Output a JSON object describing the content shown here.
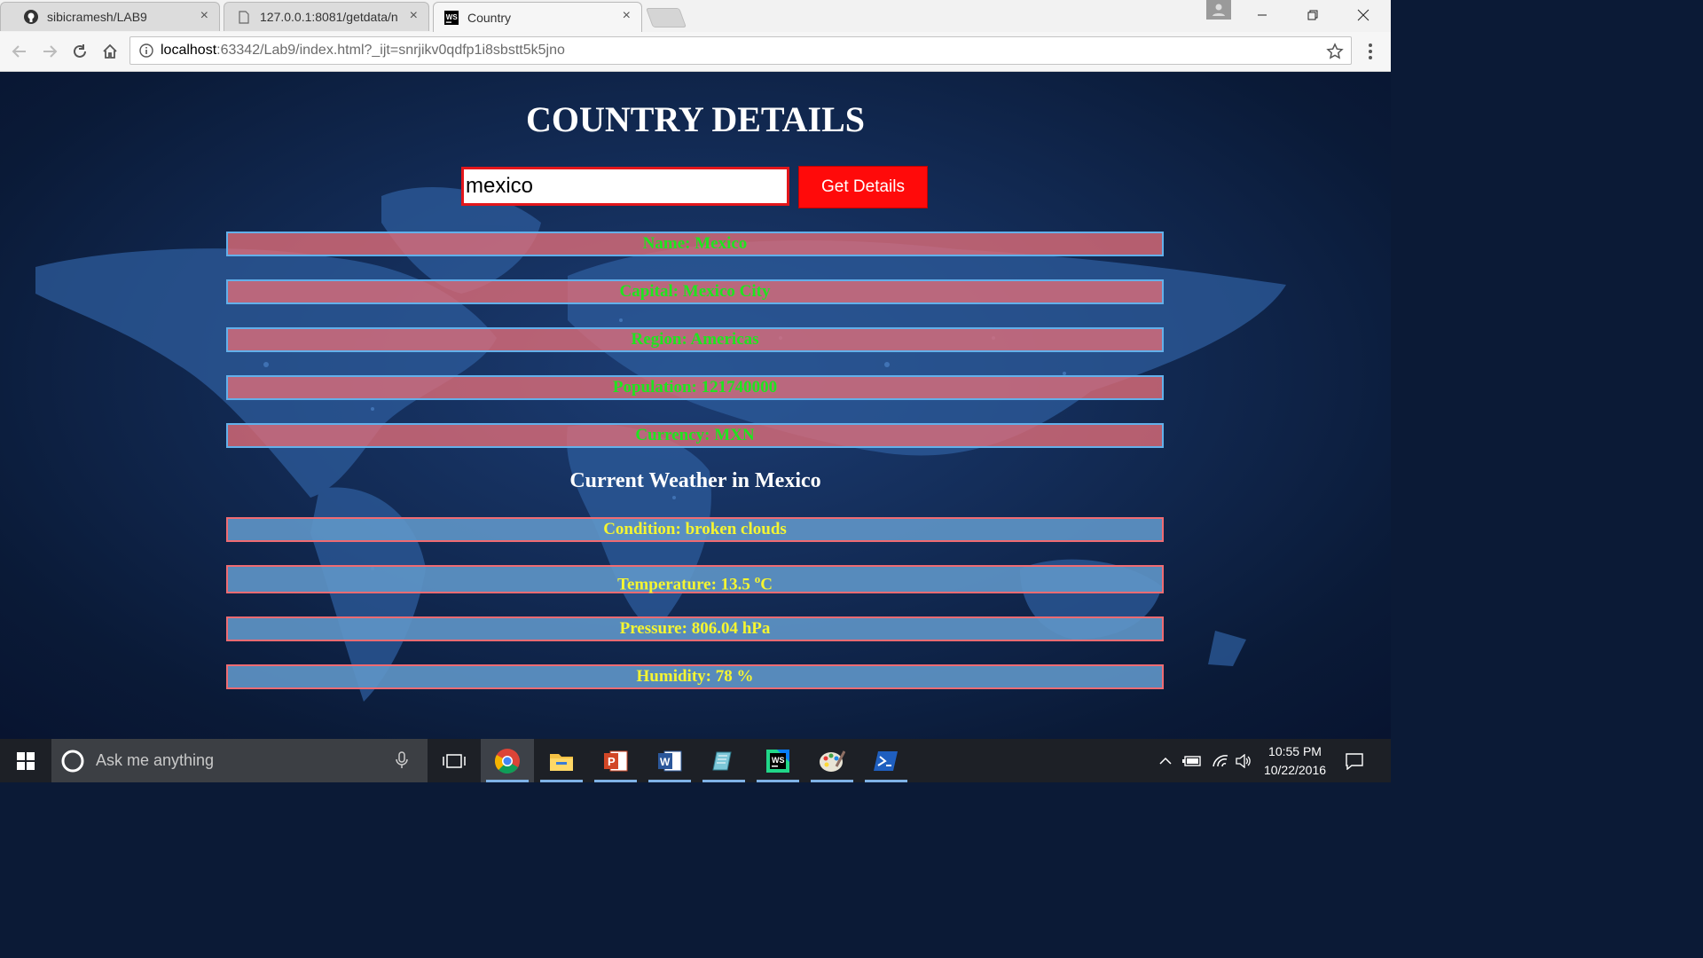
{
  "browser": {
    "tabs": [
      {
        "label": "sibicramesh/LAB9",
        "icon": "github-icon",
        "close": "×"
      },
      {
        "label": "127.0.0.1:8081/getdata/n",
        "icon": "document-icon",
        "close": "×"
      },
      {
        "label": "Country",
        "icon": "webstorm-icon",
        "close": "×"
      }
    ],
    "address": {
      "host": "localhost",
      "rest": ":63342/Lab9/index.html?_ijt=snrjikv0qdfp1i8sbstt5k5jno"
    }
  },
  "page": {
    "title": "COUNTRY DETAILS",
    "search_value": "mexico",
    "button_label": "Get Details",
    "details": [
      "Name: Mexico",
      "Capital: Mexico City",
      "Region: Americas",
      "Population: 121740000",
      "Currency: MXN"
    ],
    "weather_title": "Current Weather in Mexico",
    "weather": {
      "condition": "Condition: broken clouds",
      "temperature_prefix": "Temperature: 13.5 ",
      "temperature_sup": "o",
      "temperature_unit": "C",
      "pressure": "Pressure: 806.04 hPa",
      "humidity": "Humidity: 78 %"
    }
  },
  "taskbar": {
    "search_placeholder": "Ask me anything",
    "time": "10:55 PM",
    "date": "10/22/2016"
  }
}
